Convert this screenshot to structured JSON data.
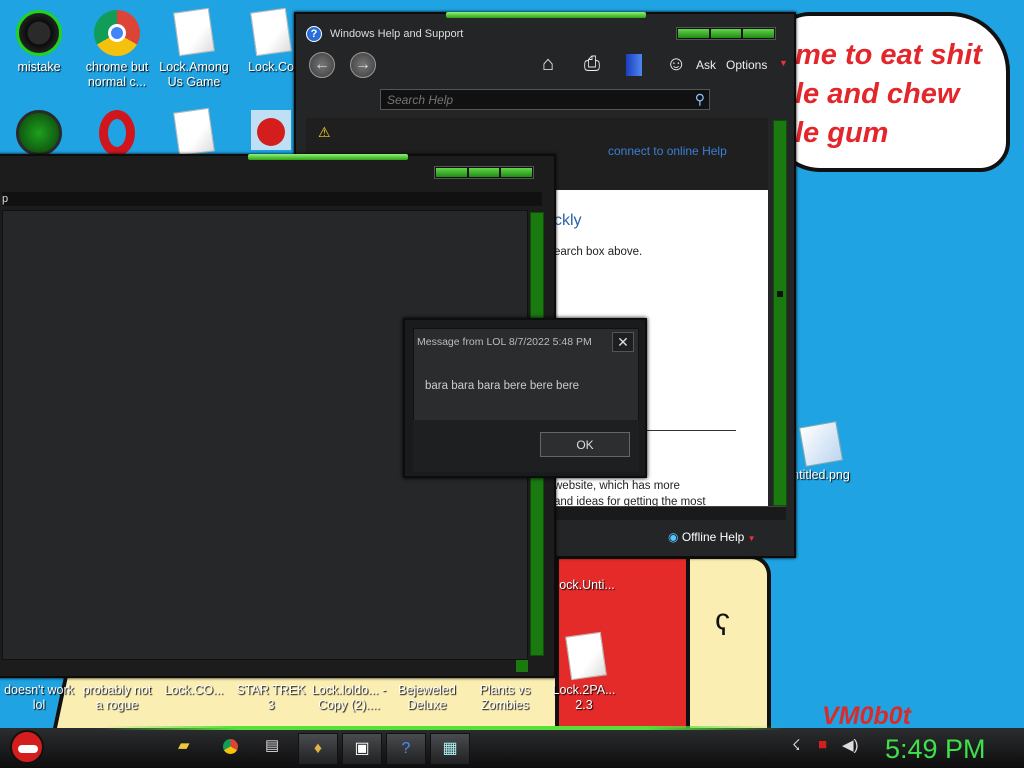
{
  "desktop_icons": [
    {
      "label": "mistake",
      "icon": "razer-icon"
    },
    {
      "label": "chrome but normal c...",
      "icon": "chrome-icon"
    },
    {
      "label": "Lock.Among Us Game",
      "icon": "document-icon"
    },
    {
      "label": "Lock.Co",
      "icon": "document-icon"
    },
    {
      "label": "",
      "icon": "recycle-bin-icon"
    },
    {
      "label": "",
      "icon": "opera-icon"
    },
    {
      "label": "",
      "icon": "document-icon"
    },
    {
      "label": "",
      "icon": "angry-bird-icon"
    }
  ],
  "bottom_icons": [
    {
      "label": "doesn't work lol"
    },
    {
      "label": "probably not a rogue"
    },
    {
      "label": "Lock.CO..."
    },
    {
      "label": "STAR TREK 3"
    },
    {
      "label": "Lock.loldo... - Copy (2)...."
    },
    {
      "label": "Bejeweled Deluxe"
    },
    {
      "label": "Plants vs Zombies"
    },
    {
      "label": "Lock.2PA... 2.3"
    }
  ],
  "right_icons": [
    {
      "label": "ock.Unti..."
    },
    {
      "label": "ntitled.png"
    }
  ],
  "wallpaper": {
    "bubble_text": "me to eat shit\nle and chew\nle gum",
    "signature": "VM0b0t"
  },
  "help_window": {
    "title": "Windows Help and Support",
    "ask_label": "Ask",
    "options_label": "Options",
    "search_placeholder": "Search Help",
    "connect_link": "connect to online Help",
    "heading_fragment": "ckly",
    "search_hint_fragment": "earch box above.",
    "footer_line1": "website, which has more",
    "footer_line2": "and ideas for getting the most",
    "offline_label": "Offline Help"
  },
  "back_window": {
    "title_fragment": "p"
  },
  "message_box": {
    "title": "Message from LOL 8/7/2022 5:48 PM",
    "message": "bara bara bara bere bere bere",
    "ok_label": "OK"
  },
  "taskbar": {
    "clock": "5:49 PM"
  },
  "colors": {
    "desktop": "#1fa3e3",
    "accent_green": "#3fcf2a",
    "clock": "#3fe04a",
    "link": "#3b7fd6"
  }
}
